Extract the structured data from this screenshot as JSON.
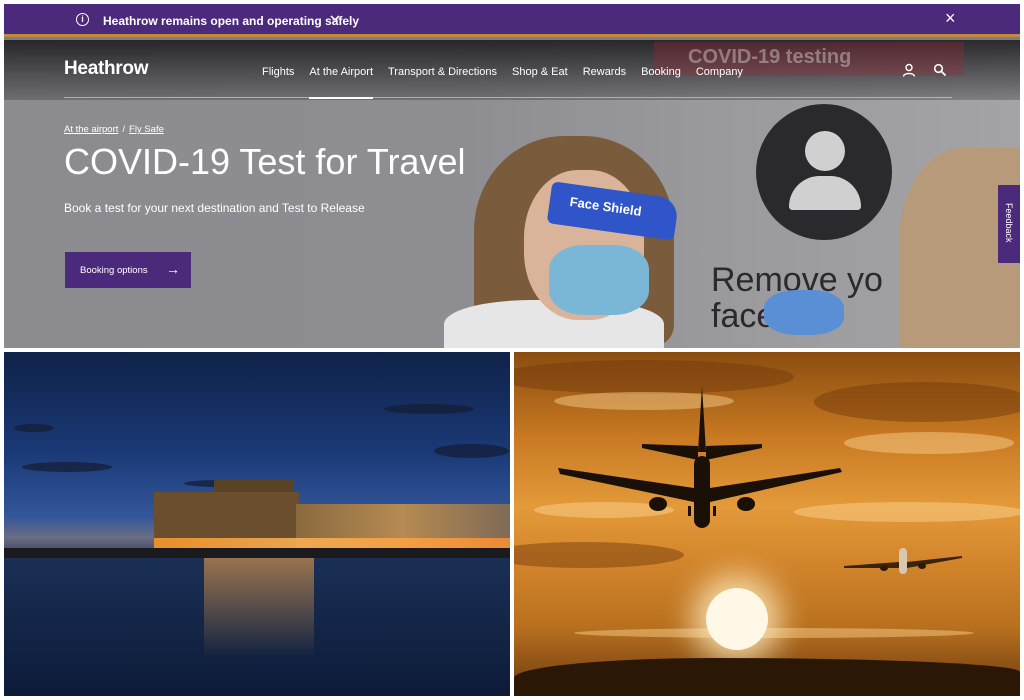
{
  "alert": {
    "info_glyph": "i",
    "text": "Heathrow remains open and operating safely",
    "chevron": "⌄",
    "close": "×"
  },
  "nav": {
    "logo": "Heathrow",
    "items": [
      "Flights",
      "At the Airport",
      "Transport & Directions",
      "Shop & Eat",
      "Rewards",
      "Booking",
      "Company"
    ],
    "active_item": "At the Airport"
  },
  "photo_text": {
    "banner": "COVID-19 testing",
    "shield": "Face Shield",
    "sign_line1": "Remove yo",
    "sign_line2": "face  erin"
  },
  "breadcrumb": {
    "items": [
      "At the airport",
      "Fly Safe"
    ],
    "separator": "/"
  },
  "hero": {
    "title": "COVID-19 Test for Travel",
    "subtitle": "Book a test for your next destination and Test to Release",
    "button_label": "Booking options",
    "button_arrow": "→"
  },
  "feedback": {
    "label": "Feedback"
  },
  "colors": {
    "brand_purple": "#4b2a7b",
    "accent_gold": "#c18b3b"
  }
}
